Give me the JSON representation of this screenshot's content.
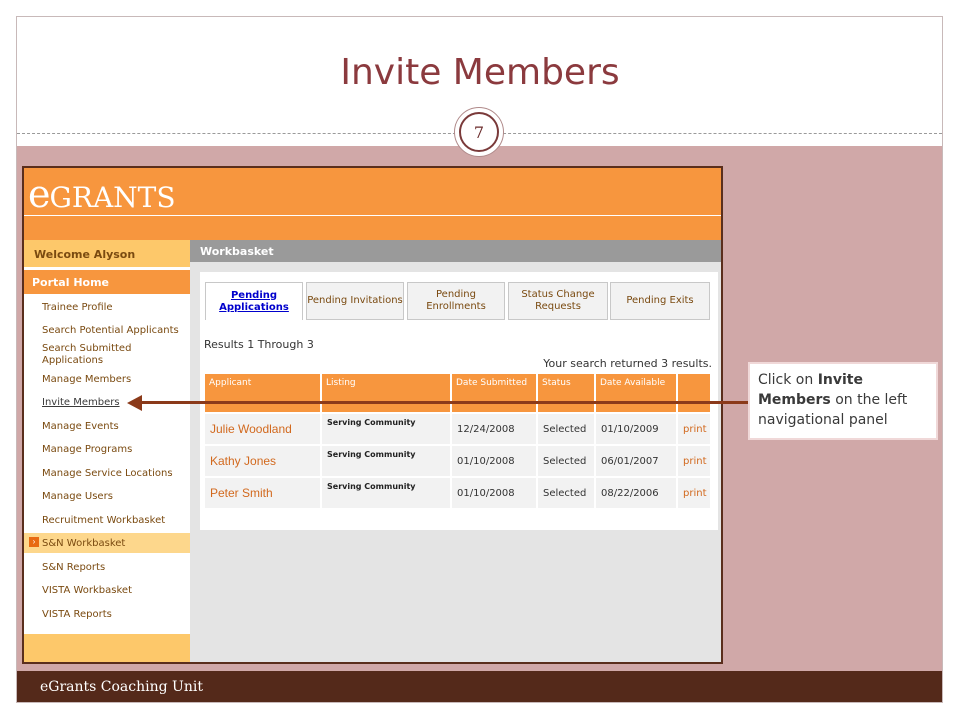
{
  "slide": {
    "title": "Invite Members",
    "page_number": "7",
    "footer": "eGrants Coaching Unit"
  },
  "app": {
    "logo_e": "e",
    "logo_rest": "GRANTS",
    "welcome": "Welcome Alyson",
    "portal_home": "Portal Home",
    "workbasket_title": "Workbasket",
    "nav": [
      "Trainee Profile",
      "Search Potential Applicants",
      "Search Submitted Applications",
      "Manage Members",
      "Invite Members",
      "Manage Events",
      "Manage Programs",
      "Manage Service Locations",
      "Manage Users",
      "Recruitment Workbasket",
      "S&N Workbasket",
      "S&N Reports",
      "VISTA Workbasket",
      "VISTA Reports"
    ],
    "tabs": [
      "Pending Applications",
      "Pending Invitations",
      "Pending Enrollments",
      "Status Change Requests",
      "Pending Exits"
    ],
    "results_range": "Results 1 Through 3",
    "results_count": "Your search returned 3 results.",
    "columns": [
      "Applicant",
      "Listing",
      "Date Submitted",
      "Status",
      "Date Available",
      ""
    ],
    "rows": [
      {
        "applicant": "Julie Woodland",
        "listing": "Serving Community",
        "submitted": "12/24/2008",
        "status": "Selected",
        "available": "01/10/2009",
        "action": "print"
      },
      {
        "applicant": "Kathy Jones",
        "listing": "Serving Community",
        "submitted": "01/10/2008",
        "status": "Selected",
        "available": "06/01/2007",
        "action": "print"
      },
      {
        "applicant": "Peter Smith",
        "listing": "Serving Community",
        "submitted": "01/10/2008",
        "status": "Selected",
        "available": "08/22/2006",
        "action": "print"
      }
    ]
  },
  "callout": {
    "pre": "Click on ",
    "bold": "Invite Members",
    "post": " on the left navigational panel"
  }
}
